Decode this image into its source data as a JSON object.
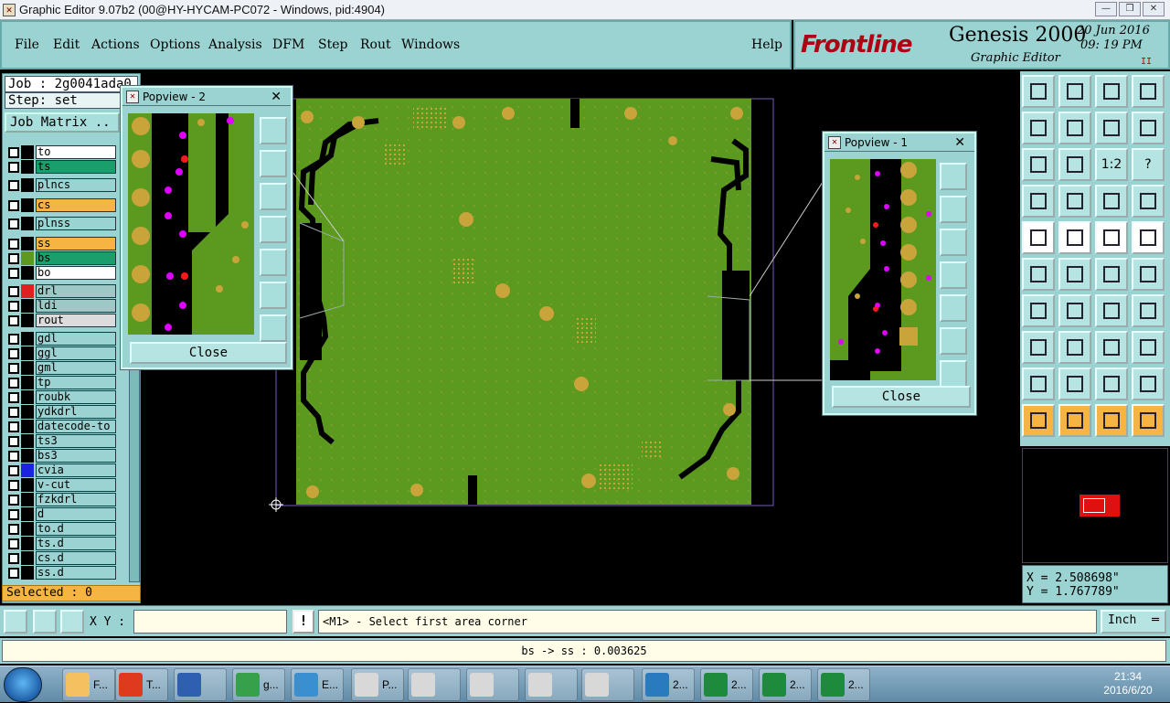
{
  "window": {
    "title": "Graphic Editor 9.07b2 (00@HY-HYCAM-PC072 - Windows, pid:4904)",
    "controls": [
      "—",
      "❒",
      "✕"
    ]
  },
  "menu": {
    "items": [
      "File",
      "Edit",
      "Actions",
      "Options",
      "Analysis",
      "DFM",
      "Step",
      "Rout",
      "Windows"
    ],
    "help": "Help"
  },
  "brand": {
    "logo": "Frontline",
    "product": "Genesis 2000",
    "subtitle": "Graphic Editor",
    "date": "20  Jun  2016",
    "time": "09: 19  PM",
    "marker": "II"
  },
  "job": {
    "job_label": "Job : 2g0041ada0",
    "step_label": "Step: set",
    "matrix_button": "Job Matrix .."
  },
  "layers": [
    {
      "name": "to",
      "color": "#ffffff",
      "swatch": "#000000"
    },
    {
      "name": "ts",
      "color": "#1a9e6b",
      "swatch": "#000000"
    },
    {
      "name": "plncs",
      "color": "#9ad3d1",
      "swatch": "#000000"
    },
    {
      "name": "cs",
      "color": "#f6b443",
      "swatch": "#000000"
    },
    {
      "name": "plnss",
      "color": "#9ad3d1",
      "swatch": "#000000"
    },
    {
      "name": "ss",
      "color": "#f6b443",
      "swatch": "#000000"
    },
    {
      "name": "bs",
      "color": "#1a9e6b",
      "swatch": "#5c9a1f"
    },
    {
      "name": "bo",
      "color": "#ffffff",
      "swatch": "#000000"
    },
    {
      "name": "drl",
      "color": "#9ec8c6",
      "swatch": "#e02020"
    },
    {
      "name": "ldi",
      "color": "#9ec8c6",
      "swatch": "#000000"
    },
    {
      "name": "rout",
      "color": "#dcdcdc",
      "swatch": "#000000"
    },
    {
      "name": "gdl",
      "color": "#9ad3d1",
      "swatch": "#000000"
    },
    {
      "name": "ggl",
      "color": "#9ad3d1",
      "swatch": "#000000"
    },
    {
      "name": "gml",
      "color": "#9ad3d1",
      "swatch": "#000000"
    },
    {
      "name": "tp",
      "color": "#9ad3d1",
      "swatch": "#000000"
    },
    {
      "name": "roubk",
      "color": "#9ad3d1",
      "swatch": "#000000"
    },
    {
      "name": "ydkdrl",
      "color": "#9ad3d1",
      "swatch": "#000000"
    },
    {
      "name": "datecode-to",
      "color": "#9ad3d1",
      "swatch": "#000000"
    },
    {
      "name": "ts3",
      "color": "#9ad3d1",
      "swatch": "#000000"
    },
    {
      "name": "bs3",
      "color": "#9ad3d1",
      "swatch": "#000000"
    },
    {
      "name": "cvia",
      "color": "#9ad3d1",
      "swatch": "#1a24e0"
    },
    {
      "name": "v-cut",
      "color": "#9ad3d1",
      "swatch": "#000000"
    },
    {
      "name": "fzkdrl",
      "color": "#9ad3d1",
      "swatch": "#000000"
    },
    {
      "name": "d",
      "color": "#9ad3d1",
      "swatch": "#000000"
    },
    {
      "name": "to.d",
      "color": "#9ad3d1",
      "swatch": "#000000"
    },
    {
      "name": "ts.d",
      "color": "#9ad3d1",
      "swatch": "#000000"
    },
    {
      "name": "cs.d",
      "color": "#9ad3d1",
      "swatch": "#000000"
    },
    {
      "name": "ss.d",
      "color": "#9ad3d1",
      "swatch": "#000000"
    }
  ],
  "selected": "Selected : 0",
  "popview2": {
    "title": "Popview - 2",
    "close": "Close",
    "x": "✕"
  },
  "popview1": {
    "title": "Popview - 1",
    "close": "Close",
    "x": "✕"
  },
  "toolbar_labels": {
    "ratio": "1:2",
    "help": "?"
  },
  "coords": {
    "x": "X = 2.508698\"",
    "y": "Y = 1.767789\""
  },
  "command": {
    "xy_label": "X Y :",
    "xy_value": "",
    "warn": "!",
    "prompt": "<M1> - Select first area corner",
    "unit": "Inch"
  },
  "status": "bs -> ss : 0.003625",
  "taskbar": {
    "items": [
      "F...",
      "T...",
      "",
      "g...",
      "E...",
      "P...",
      "",
      "",
      "",
      "",
      "2...",
      "2...",
      "2...",
      "2..."
    ],
    "time": "21:34",
    "date": "2016/6/20"
  },
  "colors": {
    "panel": "#9ad3d1",
    "board_green": "#5c9a1f",
    "pad": "#c9a43a",
    "trace": "#000000",
    "drill": "#e000ff",
    "accent_red": "#b00014"
  }
}
